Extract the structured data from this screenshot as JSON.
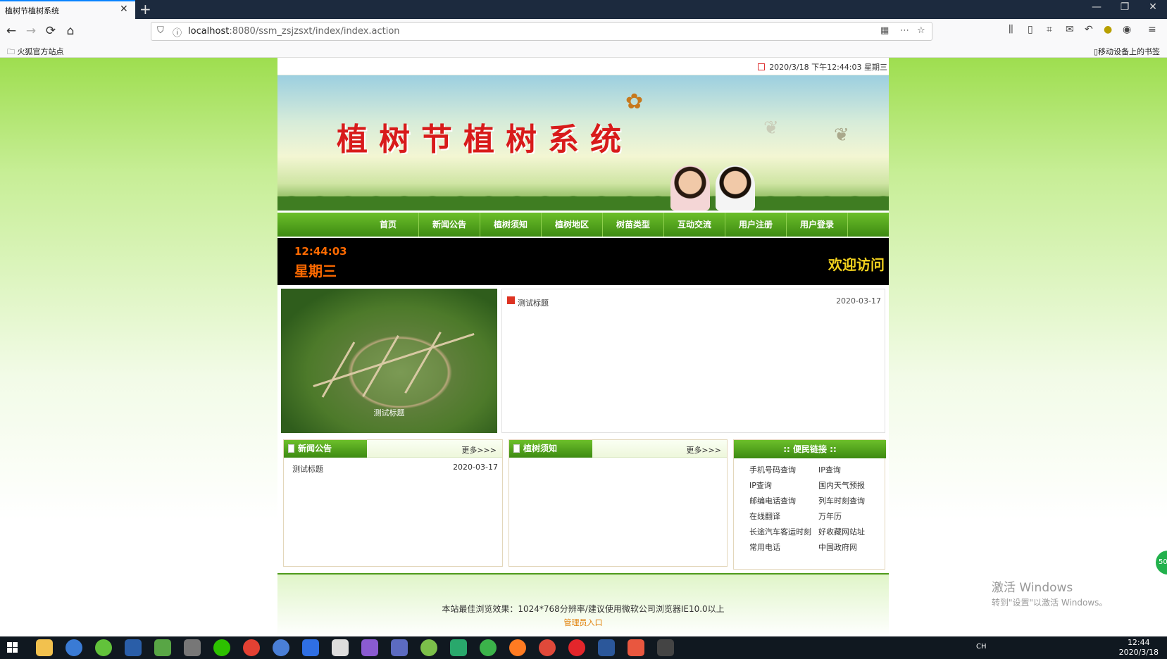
{
  "browser": {
    "tab_title": "植树节植树系统",
    "tab_close": "✕",
    "new_tab": "+",
    "url_host": "localhost",
    "url_rest": ":8080/ssm_zsjzsxt/index/index.action",
    "bookmark_left": "火狐官方站点",
    "bookmark_right": "移动设备上的书签",
    "win_min": "—",
    "win_max": "❐",
    "win_close": "✕"
  },
  "site": {
    "datetime": "2020/3/18 下午12:44:03 星期三",
    "banner_title": "植树节植树系统",
    "menu": [
      "首页",
      "新闻公告",
      "植树须知",
      "植树地区",
      "树苗类型",
      "互动交流",
      "用户注册",
      "用户登录"
    ],
    "clock_time": "12:44:03",
    "clock_day": "星期三",
    "welcome": "欢迎访问",
    "photo_caption": "测试标题",
    "news_title": "测试标题",
    "news_date": "2020-03-17",
    "panels": {
      "news": {
        "title": "新闻公告",
        "more": "更多>>>",
        "row_title": "测试标题",
        "row_date": "2020-03-17"
      },
      "guide": {
        "title": "植树须知",
        "more": "更多>>>"
      }
    },
    "links_title": ":: 便民链接 ::",
    "links": [
      "手机号码查询",
      "IP查询",
      "IP查询",
      "国内天气预报",
      "邮编电话查询",
      "列车时刻查询",
      "在线翻译",
      "万年历",
      "长途汽车客运时刻",
      "好收藏网站址",
      "常用电话",
      "中国政府网"
    ],
    "footer_text": "本站最佳浏览效果：1024*768分辨率/建议使用微软公司浏览器IE10.0以上",
    "admin_link": "管理员入口"
  },
  "system": {
    "activation_line1": "激活 Windows",
    "activation_line2": "转到\"设置\"以激活 Windows。",
    "green_badge": "50",
    "tray_lang": "CH",
    "tray_time": "12:44",
    "tray_date": "2020/3/18"
  },
  "colors": {
    "menu_green": "#3d8a12",
    "title_red": "#d81b1b",
    "clock_orange": "#ff6a00",
    "welcome_yellow": "#f3d21e"
  }
}
